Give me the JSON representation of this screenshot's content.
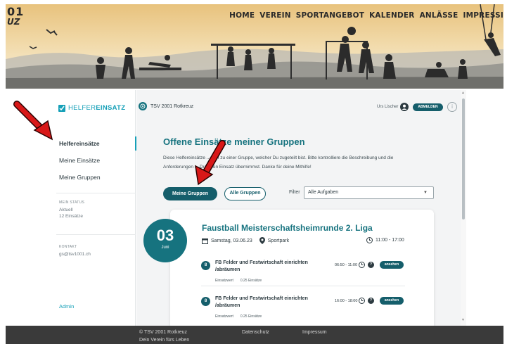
{
  "site": {
    "logo_line1": "01",
    "logo_line2": "UZ",
    "nav": [
      "HOME",
      "VEREIN",
      "SPORTANGEBOT",
      "KALENDER",
      "ANLÄSSE",
      "IMPRESSI"
    ]
  },
  "sidebar": {
    "brand_part1": "HELFER",
    "brand_part2": "EINSATZ",
    "items": [
      {
        "label": "Helfereinsätze",
        "active": true
      },
      {
        "label": "Meine Einsätze",
        "active": false
      },
      {
        "label": "Meine Gruppen",
        "active": false
      }
    ],
    "status_heading": "MEIN STATUS",
    "status_line1": "Aktuell",
    "status_line2": "12 Einsätze",
    "contact_heading": "KONTAKT",
    "contact_email": "gs@tsv1001.ch",
    "admin_label": "Admin"
  },
  "header": {
    "club_name": "TSV 2001 Rotkreuz",
    "user_name": "Urs Lischer",
    "logout_label": "ABMELDEN",
    "info_label": "i"
  },
  "main": {
    "title": "Offene Einsätze meiner Gruppen",
    "intro_line1": "Diese Helfereinsätze ... sen zu einer Gruppe, welcher Du zugeteilt bist. Bitte kontrolliere die Beschreibung und die",
    "intro_line2": "Anforderungen ... Du einen Einsatz übernimmst. Danke für deine Mithilfe!",
    "btn_my_groups": "Meine Gruppen",
    "btn_all_groups": "Alle Gruppen",
    "filter_label": "Filter",
    "filter_value": "Alle Aufgaben"
  },
  "event": {
    "day": "03",
    "month": "Juni",
    "title": "Faustball Meisterschaftsheimrunde 2. Liga",
    "date": "Samstag, 03.06.23",
    "location": "Sportpark",
    "time": "11:00 - 17:00",
    "tasks": [
      {
        "num": "8",
        "name": "FB Felder und Festwirtschaft einrichten /abräumen",
        "wert_label": "Einsatzwert",
        "wert": "0.25 Einsätze",
        "time": "06:50 - 11:00",
        "btn": "ansehen"
      },
      {
        "num": "8",
        "name": "FB Felder und Festwirtschaft einrichten /abräumen",
        "wert_label": "Einsatzwert",
        "wert": "0.25 Einsätze",
        "time": "16:00 - 18:00",
        "btn": "ansehen"
      }
    ]
  },
  "footer": {
    "copyright": "© TSV 2001 Rotkreuz",
    "slogan": "Dein Verein fürs Leben",
    "link_privacy": "Datenschutz",
    "link_imprint": "Impressum"
  },
  "colors": {
    "accent": "#16737f",
    "button": "#155e6b",
    "brand": "#16a0b8",
    "arrow": "#d81818",
    "footer": "#3a3a3a"
  }
}
